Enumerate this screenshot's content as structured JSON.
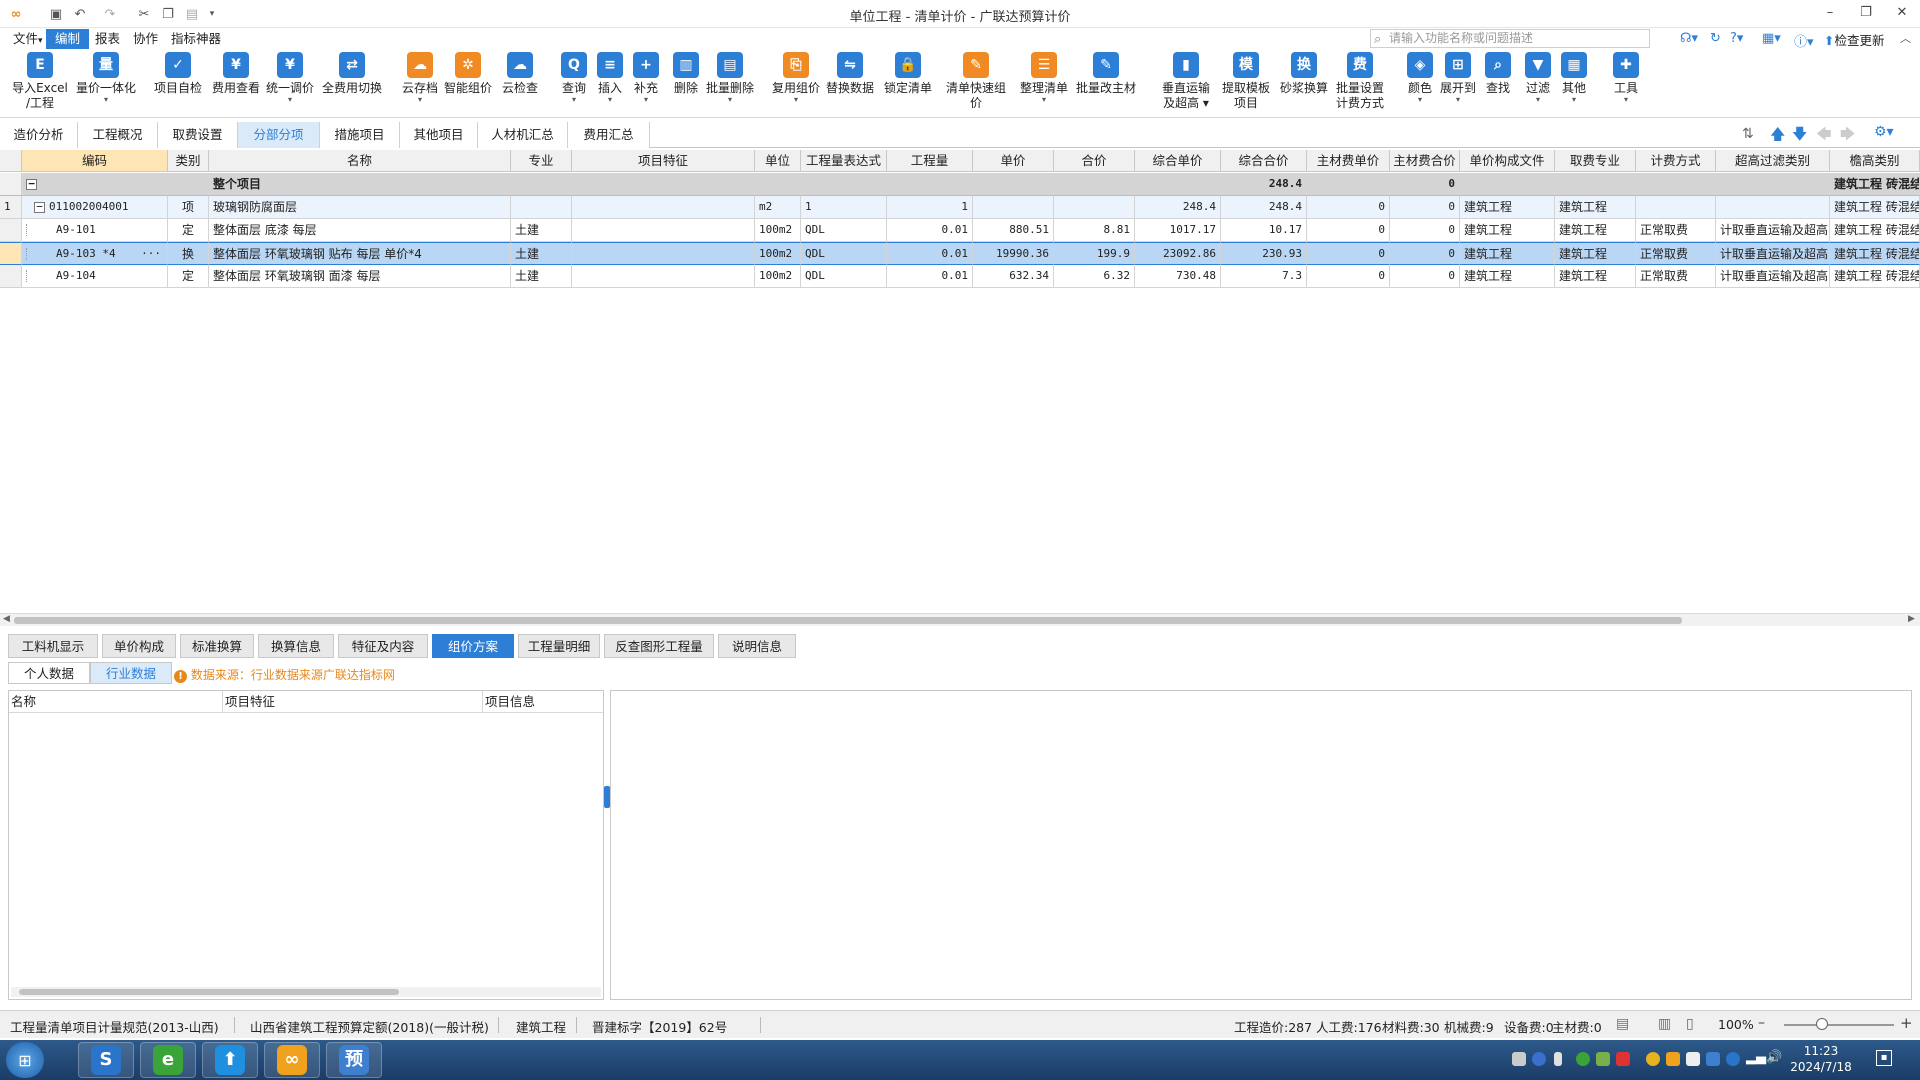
{
  "window": {
    "title": "单位工程 - 清单计价 - 广联达预算计价"
  },
  "menu": {
    "items": [
      "文件",
      "编制",
      "报表",
      "协作",
      "指标神器"
    ],
    "active_index": 1
  },
  "search": {
    "placeholder": "请输入功能名称或问题描述"
  },
  "topright": {
    "update_label": "检查更新"
  },
  "toolbar": [
    {
      "l1": "导入Excel",
      "l2": "/工程",
      "color": "#2d7fd6",
      "g": "E"
    },
    {
      "l1": "量价一体化",
      "l2": "▾",
      "color": "#2d7fd6",
      "g": "量"
    },
    {
      "l1": "项目自检",
      "l2": "",
      "color": "#2d7fd6",
      "g": "✓"
    },
    {
      "l1": "费用查看",
      "l2": "",
      "color": "#2d7fd6",
      "g": "¥"
    },
    {
      "l1": "统一调价",
      "l2": "▾",
      "color": "#2d7fd6",
      "g": "¥"
    },
    {
      "l1": "全费用切换",
      "l2": "",
      "color": "#2d7fd6",
      "g": "⇄"
    },
    {
      "l1": "云存档",
      "l2": "▾",
      "color": "#f08a24",
      "g": "☁"
    },
    {
      "l1": "智能组价",
      "l2": "",
      "color": "#f08a24",
      "g": "✲"
    },
    {
      "l1": "云检查",
      "l2": "",
      "color": "#2d7fd6",
      "g": "☁"
    },
    {
      "l1": "查询",
      "l2": "▾",
      "color": "#2d7fd6",
      "g": "Q"
    },
    {
      "l1": "插入",
      "l2": "▾",
      "color": "#2d7fd6",
      "g": "≡"
    },
    {
      "l1": "补充",
      "l2": "▾",
      "color": "#2d7fd6",
      "g": "+"
    },
    {
      "l1": "删除",
      "l2": "",
      "color": "#2d7fd6",
      "g": "▥"
    },
    {
      "l1": "批量删除",
      "l2": "▾",
      "color": "#2d7fd6",
      "g": "▤"
    },
    {
      "l1": "复用组价",
      "l2": "▾",
      "color": "#f08a24",
      "g": "⎘"
    },
    {
      "l1": "替换数据",
      "l2": "",
      "color": "#2d7fd6",
      "g": "⇋"
    },
    {
      "l1": "锁定清单",
      "l2": "",
      "color": "#2d7fd6",
      "g": "🔒"
    },
    {
      "l1": "清单快速组价",
      "l2": "",
      "color": "#f08a24",
      "g": "✎"
    },
    {
      "l1": "整理清单",
      "l2": "▾",
      "color": "#f08a24",
      "g": "☰"
    },
    {
      "l1": "批量改主材",
      "l2": "",
      "color": "#2d7fd6",
      "g": "✎"
    },
    {
      "l1": "垂直运输",
      "l2": "及超高 ▾",
      "color": "#2d7fd6",
      "g": "▮"
    },
    {
      "l1": "提取模板",
      "l2": "项目",
      "color": "#2d7fd6",
      "g": "模"
    },
    {
      "l1": "砂浆换算",
      "l2": "",
      "color": "#2d7fd6",
      "g": "换"
    },
    {
      "l1": "批量设置",
      "l2": "计费方式",
      "color": "#2d7fd6",
      "g": "费"
    },
    {
      "l1": "颜色",
      "l2": "▾",
      "color": "#2d7fd6",
      "g": "◈"
    },
    {
      "l1": "展开到",
      "l2": "▾",
      "color": "#2d7fd6",
      "g": "⊞"
    },
    {
      "l1": "查找",
      "l2": "",
      "color": "#2d7fd6",
      "g": "⌕"
    },
    {
      "l1": "过滤",
      "l2": "▾",
      "color": "#2d7fd6",
      "g": "▼"
    },
    {
      "l1": "其他",
      "l2": "▾",
      "color": "#2d7fd6",
      "g": "▦"
    },
    {
      "l1": "工具",
      "l2": "▾",
      "color": "#2d7fd6",
      "g": "✚"
    }
  ],
  "view_tabs": {
    "items": [
      "造价分析",
      "工程概况",
      "取费设置",
      "分部分项",
      "措施项目",
      "其他项目",
      "人材机汇总",
      "费用汇总"
    ],
    "active_index": 3
  },
  "grid": {
    "headers": [
      "编码",
      "类别",
      "名称",
      "专业",
      "项目特征",
      "单位",
      "工程量表达式",
      "工程量",
      "单价",
      "合价",
      "综合单价",
      "综合合价",
      "主材费单价",
      "主材费合价",
      "单价构成文件",
      "取费专业",
      "计费方式",
      "超高过滤类别",
      "檐高类别"
    ],
    "rows": [
      {
        "idx": "",
        "tree": "−",
        "code": "",
        "type": "",
        "name": "整个项目",
        "major": "",
        "feature": "",
        "unit": "",
        "expr": "",
        "qty": "",
        "price": "",
        "total": "",
        "cprice": "",
        "ctotal": "248.4",
        "mprice": "",
        "mtotal": "0",
        "file": "",
        "feemajor": "",
        "method": "",
        "filter": "",
        "eave": "建筑工程 砖混结构"
      },
      {
        "idx": "1",
        "tree": "−",
        "code": "011002004001",
        "type": "项",
        "name": "玻璃钢防腐面层",
        "major": "",
        "feature": "",
        "unit": "m2",
        "expr": "1",
        "qty": "1",
        "price": "",
        "total": "",
        "cprice": "248.4",
        "ctotal": "248.4",
        "mprice": "0",
        "mtotal": "0",
        "file": "建筑工程",
        "feemajor": "建筑工程",
        "method": "",
        "filter": "",
        "eave": "建筑工程 砖混结构"
      },
      {
        "idx": "",
        "tree": "",
        "code": "A9-101",
        "type": "定",
        "name": "整体面层 底漆 每层",
        "major": "土建",
        "feature": "",
        "unit": "100m2",
        "expr": "QDL",
        "qty": "0.01",
        "price": "880.51",
        "total": "8.81",
        "cprice": "1017.17",
        "ctotal": "10.17",
        "mprice": "0",
        "mtotal": "0",
        "file": "建筑工程",
        "feemajor": "建筑工程",
        "method": "正常取费",
        "filter": "计取垂直运输及超高",
        "eave": "建筑工程 砖混结构"
      },
      {
        "idx": "",
        "tree": "",
        "code": "A9-103 *4",
        "type": "换",
        "name": "整体面层 环氧玻璃钢 贴布 每层  单价*4",
        "major": "土建",
        "feature": "",
        "unit": "100m2",
        "expr": "QDL",
        "qty": "0.01",
        "price": "19990.36",
        "total": "199.9",
        "cprice": "23092.86",
        "ctotal": "230.93",
        "mprice": "0",
        "mtotal": "0",
        "file": "建筑工程",
        "feemajor": "建筑工程",
        "method": "正常取费",
        "filter": "计取垂直运输及超高",
        "eave": "建筑工程 砖混结构"
      },
      {
        "idx": "",
        "tree": "",
        "code": "A9-104",
        "type": "定",
        "name": "整体面层 环氧玻璃钢 面漆 每层",
        "major": "土建",
        "feature": "",
        "unit": "100m2",
        "expr": "QDL",
        "qty": "0.01",
        "price": "632.34",
        "total": "6.32",
        "cprice": "730.48",
        "ctotal": "7.3",
        "mprice": "0",
        "mtotal": "0",
        "file": "建筑工程",
        "feemajor": "建筑工程",
        "method": "正常取费",
        "filter": "计取垂直运输及超高",
        "eave": "建筑工程 砖混结构"
      }
    ],
    "ellipsis": "···"
  },
  "bottom_tabs": {
    "items": [
      "工料机显示",
      "单价构成",
      "标准换算",
      "换算信息",
      "特征及内容",
      "组价方案",
      "工程量明细",
      "反查图形工程量",
      "说明信息"
    ],
    "active_index": 5
  },
  "sub_tabs": {
    "items": [
      "个人数据",
      "行业数据"
    ],
    "active_index": 1
  },
  "notice": "数据来源：行业数据来源广联达指标网",
  "left_pane": {
    "headers": [
      "名称",
      "项目特征",
      "项目信息"
    ]
  },
  "status": {
    "left": [
      "工程量清单项目计量规范(2013-山西)",
      "山西省建筑工程预算定额(2018)(一般计税)",
      "建筑工程",
      "晋建标字【2019】62号"
    ],
    "right": [
      "工程造价:287",
      "人工费:176",
      "材料费:30",
      "机械费:9",
      "设备费:0",
      "主材费:0"
    ],
    "zoom": "100%"
  },
  "taskbar": {
    "apps": [
      {
        "g": "S",
        "c": "#2a74c9"
      },
      {
        "g": "e",
        "c": "#3aa33a"
      },
      {
        "g": "⬆",
        "c": "#1f8fe0"
      },
      {
        "g": "∞",
        "c": "#f0a11e"
      },
      {
        "g": "预",
        "c": "#3f7fd0"
      }
    ],
    "time": "11:23",
    "date": "2024/7/18"
  },
  "colors": {
    "accent": "#2d7fd6",
    "selected_row": "#b9d6f5",
    "warning": "#e8881a"
  }
}
